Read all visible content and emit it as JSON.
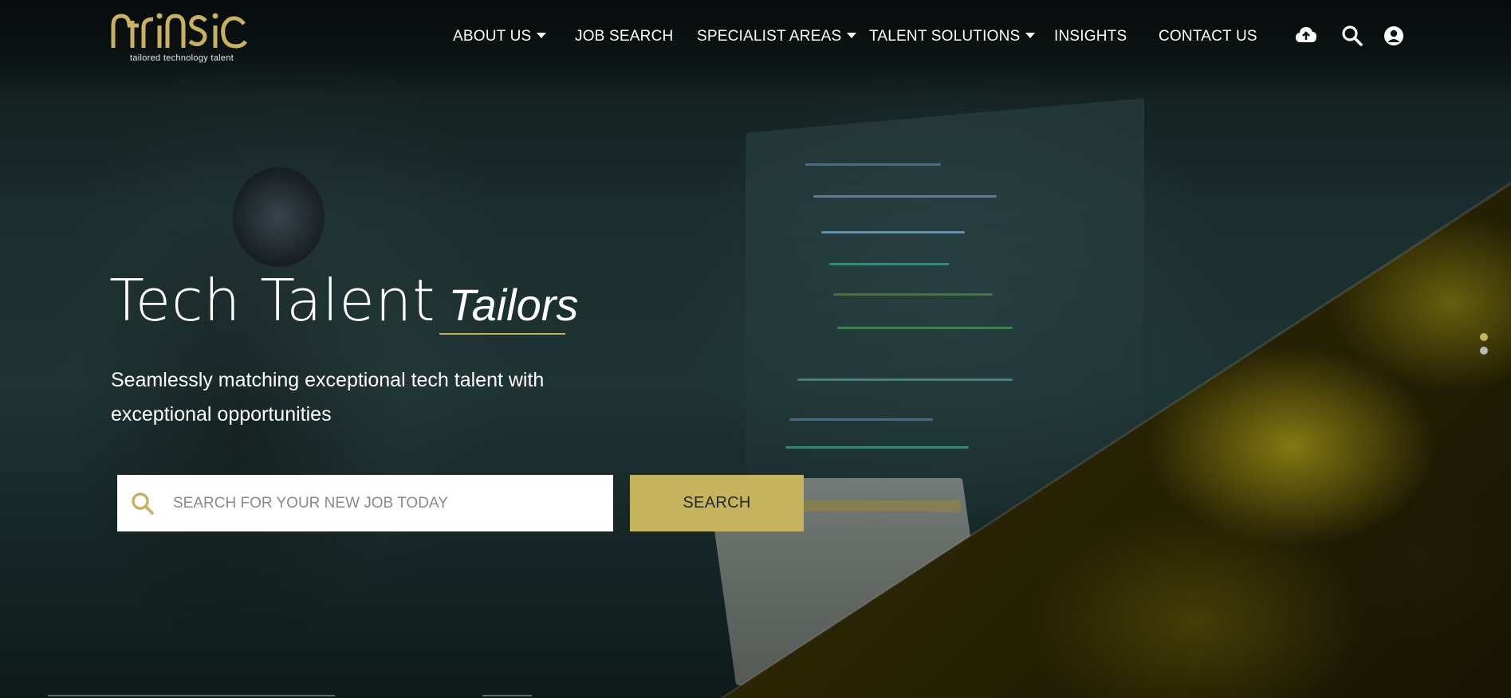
{
  "brand": {
    "logo_word": "ntrinsic",
    "tagline": "tailored technology talent"
  },
  "nav": {
    "items": [
      {
        "label": "ABOUT US",
        "dropdown": true
      },
      {
        "label": "JOB SEARCH",
        "dropdown": false
      },
      {
        "label": "SPECIALIST AREAS",
        "dropdown": true
      },
      {
        "label": "TALENT SOLUTIONS",
        "dropdown": true
      },
      {
        "label": "INSIGHTS",
        "dropdown": false
      },
      {
        "label": "CONTACT US",
        "dropdown": false
      }
    ],
    "icons": [
      "cloud-upload-icon",
      "search-icon",
      "user-account-icon"
    ]
  },
  "hero": {
    "title_main": "Tech Talent",
    "title_accent": "Tailors",
    "subtitle": "Seamlessly matching exceptional tech talent with exceptional opportunities"
  },
  "search": {
    "placeholder": "SEARCH FOR YOUR NEW JOB TODAY",
    "value": "",
    "button_label": "SEARCH"
  },
  "slider": {
    "slide_count": 2,
    "active_index": 0
  },
  "colors": {
    "accent_gold": "#c5b35e",
    "text_white": "#ffffff",
    "button_text": "#1d2b2b",
    "dot_inactive": "#b9b9b9"
  }
}
